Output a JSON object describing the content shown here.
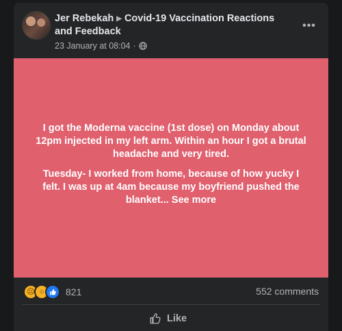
{
  "post": {
    "author": "Jer Rebekah",
    "group": "Covid-19 Vaccination Reactions and Feedback",
    "timestamp": "23 January at 08:04",
    "audience_icon": "globe-icon",
    "more_icon": "more-options-icon",
    "body_bg_color": "#e0606e",
    "paragraph1": "I got the Moderna vaccine (1st dose) on Monday about 12pm injected in my left arm. Within an hour I got a brutal headache and very tired.",
    "paragraph2": "Tuesday- I worked from home, because of how yucky I felt. I was up at 4am because my boyfriend pushed the blanket...",
    "see_more": "See more"
  },
  "engagement": {
    "reaction_icons": [
      "sad-reaction-icon",
      "wow-reaction-icon",
      "like-reaction-icon"
    ],
    "reaction_count": "821",
    "comments": "552 comments"
  },
  "actions": {
    "like_label": "Like",
    "like_icon": "thumbs-up-icon"
  }
}
